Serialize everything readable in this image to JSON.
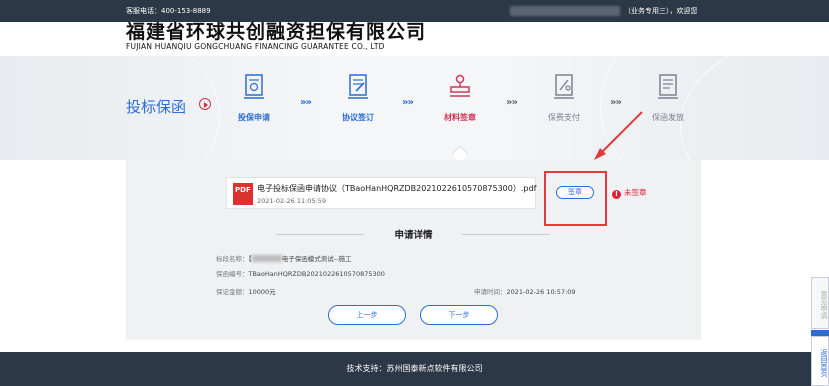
{
  "topbar": {
    "phone": "客服电话：400-153-8889",
    "user": "（业务专用三），欢迎您"
  },
  "header": {
    "company_cn": "福建省环球共创融资担保有限公司",
    "company_en": "FUJIAN HUANQIU GONGCHUANG FINANCING GUARANTEE CO., LTD"
  },
  "banner": {
    "product": "投标保函",
    "steps": [
      {
        "label": "投保申请",
        "state": "done",
        "icon": "application-icon"
      },
      {
        "label": "协议签订",
        "state": "done",
        "icon": "agreement-icon"
      },
      {
        "label": "材料签章",
        "state": "active",
        "icon": "stamp-icon"
      },
      {
        "label": "保费支付",
        "state": "todo",
        "icon": "payment-icon"
      },
      {
        "label": "保函发放",
        "state": "todo",
        "icon": "issue-icon"
      }
    ],
    "separator": "»»"
  },
  "document": {
    "name": "电子投标保函申请协议（TBaoHanHQRZDB2021022610570875300）.pdf",
    "time": "2021-02-26 11:05:59",
    "pdf_badge": "PDF"
  },
  "sign": {
    "button": "签章",
    "status": "未签章",
    "status_mark": "!"
  },
  "details": {
    "title": "申请详情",
    "bid_label": "标段名称：",
    "bid_prefix": "【",
    "bid_value": "电子保函模式测试--施工",
    "no_label": "保函编号：",
    "no_value": "TBaoHanHQRZDB2021022610570875300",
    "amount_label": "保证金额：",
    "amount_value": "10000元",
    "apply_time_label": "申请时间：",
    "apply_time_value": "2021-02-26 10:57:09"
  },
  "buttons": {
    "prev": "上一步",
    "next": "下一步"
  },
  "footer": {
    "support": "技术支持：苏州国泰新点软件有限公司"
  },
  "side": {
    "tool1": "意见申请",
    "tool2": "返回首页"
  },
  "colors": {
    "accent": "#2c6dd5",
    "active": "#d4365a",
    "alert": "#e23a3a",
    "dark": "#2c3847"
  }
}
